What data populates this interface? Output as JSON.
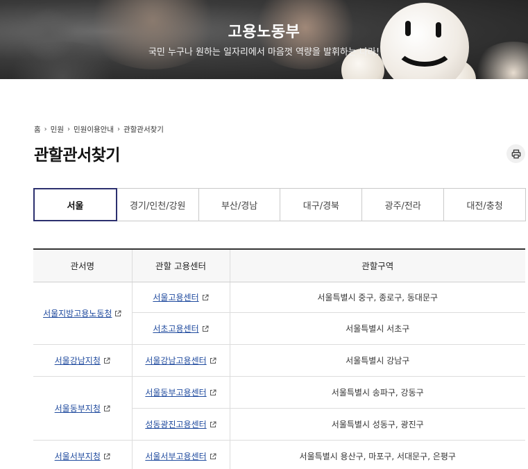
{
  "hero": {
    "title": "고용노동부",
    "subtitle": "국민 누구나 원하는 일자리에서 마음껏 역량을 발휘하는 나라!"
  },
  "breadcrumb": [
    "홈",
    "민원",
    "민원이용안내",
    "관할관서찾기"
  ],
  "page_title": "관할관서찾기",
  "tabs": [
    "서울",
    "경기/인천/강원",
    "부산/경남",
    "대구/경북",
    "광주/전라",
    "대전/충청"
  ],
  "active_tab": "서울",
  "table": {
    "headers": [
      "관서명",
      "관할 고용센터",
      "관할구역"
    ],
    "rows": [
      {
        "office": "서울지방고용노동청",
        "center": "서울고용센터",
        "area": "서울특별시 중구, 종로구, 동대문구"
      },
      {
        "office": "",
        "center": "서초고용센터",
        "area": "서울특별시 서초구"
      },
      {
        "office": "서울강남지청",
        "center": "서울강남고용센터",
        "area": "서울특별시 강남구"
      },
      {
        "office": "서울동부지청",
        "center": "서울동부고용센터",
        "area": "서울특별시 송파구, 강동구"
      },
      {
        "office": "",
        "center": "성동광진고용센터",
        "area": "서울특별시 성동구, 광진구"
      },
      {
        "office": "서울서부지청",
        "center": "서울서부고용센터",
        "area": "서울특별시 용산구, 마포구, 서대문구, 은평구"
      }
    ]
  },
  "colors": {
    "active_tab_border": "#2b2f6e",
    "link": "#1f4a9e",
    "header_bg": "#f7f7f7"
  },
  "icons": {
    "print": "printer-icon",
    "external": "external-link-icon",
    "breadcrumb_sep": "chevron-right-icon"
  }
}
